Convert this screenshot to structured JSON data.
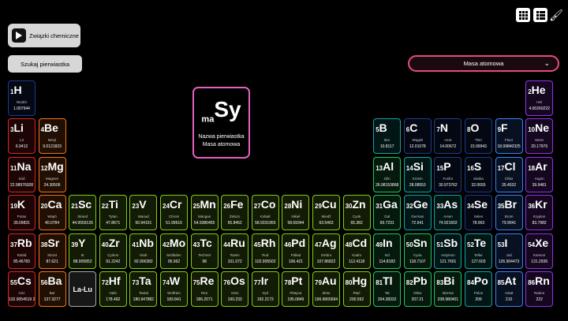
{
  "toolbar": {
    "compounds_label": "Związki chemiczne",
    "search_label": "Szukaj pierwiastka",
    "property_select": "Masa atomowa"
  },
  "legend": {
    "mass_sub": "m",
    "z_sub": "a",
    "symbol": "Sy",
    "name_label": "Nazwa pierwiastka",
    "mass_label": "Masa atomowa"
  },
  "colors": {
    "nonmetal": "#1e3a8a",
    "noble": "#9333ea",
    "alkali": "#dc2626",
    "alkaline": "#f97316",
    "transition": "#84cc16",
    "post": "#22c55e",
    "metalloid": "#0ea5a4",
    "halogen": "#3b82f6",
    "lanth": "#aaaaaa"
  },
  "elements": [
    {
      "z": "1",
      "s": "H",
      "n": "Wodór",
      "m": "1.007944",
      "c": "nonmetal",
      "g": 1,
      "r": 1
    },
    {
      "z": "2",
      "s": "He",
      "n": "Hel",
      "m": "4.00260222",
      "c": "noble",
      "g": 18,
      "r": 1
    },
    {
      "z": "3",
      "s": "Li",
      "n": "Lit",
      "m": "6.9412",
      "c": "alkali",
      "g": 1,
      "r": 2
    },
    {
      "z": "4",
      "s": "Be",
      "n": "Beryl",
      "m": "9.0121823",
      "c": "alkaline",
      "g": 2,
      "r": 2
    },
    {
      "z": "5",
      "s": "B",
      "n": "Bor",
      "m": "10.8117",
      "c": "metalloid",
      "g": 13,
      "r": 2
    },
    {
      "z": "6",
      "s": "C",
      "n": "Węgiel",
      "m": "12.01078",
      "c": "nonmetal",
      "g": 14,
      "r": 2
    },
    {
      "z": "7",
      "s": "N",
      "n": "Azot",
      "m": "14.00672",
      "c": "nonmetal",
      "g": 15,
      "r": 2
    },
    {
      "z": "8",
      "s": "O",
      "n": "Tlen",
      "m": "15.99943",
      "c": "nonmetal",
      "g": 16,
      "r": 2
    },
    {
      "z": "9",
      "s": "F",
      "n": "Fluor",
      "m": "18.99840325",
      "c": "halogen",
      "g": 17,
      "r": 2
    },
    {
      "z": "10",
      "s": "Ne",
      "n": "Neon",
      "m": "20.17976",
      "c": "noble",
      "g": 18,
      "r": 2
    },
    {
      "z": "11",
      "s": "Na",
      "n": "Sód",
      "m": "22.98976928",
      "c": "alkali",
      "g": 1,
      "r": 3
    },
    {
      "z": "12",
      "s": "Mg",
      "n": "Magnez",
      "m": "24.30506",
      "c": "alkaline",
      "g": 2,
      "r": 3
    },
    {
      "z": "13",
      "s": "Al",
      "n": "Glin",
      "m": "26.98153868",
      "c": "post",
      "g": 13,
      "r": 3
    },
    {
      "z": "14",
      "s": "Si",
      "n": "Krzem",
      "m": "28.08553",
      "c": "metalloid",
      "g": 14,
      "r": 3
    },
    {
      "z": "15",
      "s": "P",
      "n": "Fosfor",
      "m": "30.973762",
      "c": "nonmetal",
      "g": 15,
      "r": 3
    },
    {
      "z": "16",
      "s": "S",
      "n": "Siarka",
      "m": "32.0655",
      "c": "nonmetal",
      "g": 16,
      "r": 3
    },
    {
      "z": "17",
      "s": "Cl",
      "n": "Chlor",
      "m": "35.4532",
      "c": "halogen",
      "g": 17,
      "r": 3
    },
    {
      "z": "18",
      "s": "Ar",
      "n": "Argon",
      "m": "39.9481",
      "c": "noble",
      "g": 18,
      "r": 3
    },
    {
      "z": "19",
      "s": "K",
      "n": "Potas",
      "m": "39.09831",
      "c": "alkali",
      "g": 1,
      "r": 4
    },
    {
      "z": "20",
      "s": "Ca",
      "n": "Wapń",
      "m": "40.0784",
      "c": "alkaline",
      "g": 2,
      "r": 4
    },
    {
      "z": "21",
      "s": "Sc",
      "n": "Skand",
      "m": "44.9559126",
      "c": "transition",
      "g": 3,
      "r": 4
    },
    {
      "z": "22",
      "s": "Ti",
      "n": "Tytan",
      "m": "47.8671",
      "c": "transition",
      "g": 4,
      "r": 4
    },
    {
      "z": "23",
      "s": "V",
      "n": "Wanad",
      "m": "50.94151",
      "c": "transition",
      "g": 5,
      "r": 4
    },
    {
      "z": "24",
      "s": "Cr",
      "n": "Chrom",
      "m": "51.99616",
      "c": "transition",
      "g": 6,
      "r": 4
    },
    {
      "z": "25",
      "s": "Mn",
      "n": "Mangan",
      "m": "54.9380455",
      "c": "transition",
      "g": 7,
      "r": 4
    },
    {
      "z": "26",
      "s": "Fe",
      "n": "Żelazo",
      "m": "55.8452",
      "c": "transition",
      "g": 8,
      "r": 4
    },
    {
      "z": "27",
      "s": "Co",
      "n": "Kobalt",
      "m": "58.9331955",
      "c": "transition",
      "g": 9,
      "r": 4
    },
    {
      "z": "28",
      "s": "Ni",
      "n": "Nikiel",
      "m": "58.69344",
      "c": "transition",
      "g": 10,
      "r": 4
    },
    {
      "z": "29",
      "s": "Cu",
      "n": "Miedź",
      "m": "63.5463",
      "c": "transition",
      "g": 11,
      "r": 4
    },
    {
      "z": "30",
      "s": "Zn",
      "n": "Cynk",
      "m": "65.382",
      "c": "transition",
      "g": 12,
      "r": 4
    },
    {
      "z": "31",
      "s": "Ga",
      "n": "Gal",
      "m": "69.7231",
      "c": "post",
      "g": 13,
      "r": 4
    },
    {
      "z": "32",
      "s": "Ge",
      "n": "German",
      "m": "72.641",
      "c": "metalloid",
      "g": 14,
      "r": 4
    },
    {
      "z": "33",
      "s": "As",
      "n": "Arsen",
      "m": "74.921602",
      "c": "metalloid",
      "g": 15,
      "r": 4
    },
    {
      "z": "34",
      "s": "Se",
      "n": "Selen",
      "m": "78.963",
      "c": "nonmetal",
      "g": 16,
      "r": 4
    },
    {
      "z": "35",
      "s": "Br",
      "n": "Brom",
      "m": "79.9041",
      "c": "halogen",
      "g": 17,
      "r": 4
    },
    {
      "z": "36",
      "s": "Kr",
      "n": "Krypton",
      "m": "83.7982",
      "c": "noble",
      "g": 18,
      "r": 4
    },
    {
      "z": "37",
      "s": "Rb",
      "n": "Rubid",
      "m": "85.46783",
      "c": "alkali",
      "g": 1,
      "r": 5
    },
    {
      "z": "38",
      "s": "Sr",
      "n": "Stront",
      "m": "87.621",
      "c": "alkaline",
      "g": 2,
      "r": 5
    },
    {
      "z": "39",
      "s": "Y",
      "n": "Itr",
      "m": "88.905852",
      "c": "transition",
      "g": 3,
      "r": 5
    },
    {
      "z": "40",
      "s": "Zr",
      "n": "Cyrkon",
      "m": "91.2242",
      "c": "transition",
      "g": 4,
      "r": 5
    },
    {
      "z": "41",
      "s": "Nb",
      "n": "Niob",
      "m": "92.906382",
      "c": "transition",
      "g": 5,
      "r": 5
    },
    {
      "z": "42",
      "s": "Mo",
      "n": "Molibden",
      "m": "95.962",
      "c": "transition",
      "g": 6,
      "r": 5
    },
    {
      "z": "43",
      "s": "Tc",
      "n": "Technet",
      "m": "98",
      "c": "transition",
      "g": 7,
      "r": 5
    },
    {
      "z": "44",
      "s": "Ru",
      "n": "Ruten",
      "m": "101.072",
      "c": "transition",
      "g": 8,
      "r": 5
    },
    {
      "z": "45",
      "s": "Rh",
      "n": "Rod",
      "m": "102.905502",
      "c": "transition",
      "g": 9,
      "r": 5
    },
    {
      "z": "46",
      "s": "Pd",
      "n": "Pallad",
      "m": "106.421",
      "c": "transition",
      "g": 10,
      "r": 5
    },
    {
      "z": "47",
      "s": "Ag",
      "n": "Srebro",
      "m": "107.86822",
      "c": "transition",
      "g": 11,
      "r": 5
    },
    {
      "z": "48",
      "s": "Cd",
      "n": "Kadm",
      "m": "112.4118",
      "c": "transition",
      "g": 12,
      "r": 5
    },
    {
      "z": "49",
      "s": "In",
      "n": "Ind",
      "m": "114.8183",
      "c": "post",
      "g": 13,
      "r": 5
    },
    {
      "z": "50",
      "s": "Sn",
      "n": "Cyna",
      "m": "118.7107",
      "c": "post",
      "g": 14,
      "r": 5
    },
    {
      "z": "51",
      "s": "Sb",
      "n": "Antymon",
      "m": "121.7601",
      "c": "metalloid",
      "g": 15,
      "r": 5
    },
    {
      "z": "52",
      "s": "Te",
      "n": "Tellur",
      "m": "127.603",
      "c": "metalloid",
      "g": 16,
      "r": 5
    },
    {
      "z": "53",
      "s": "I",
      "n": "Jod",
      "m": "126.904473",
      "c": "halogen",
      "g": 17,
      "r": 5
    },
    {
      "z": "54",
      "s": "Xe",
      "n": "Ksenon",
      "m": "131.2936",
      "c": "noble",
      "g": 18,
      "r": 5
    },
    {
      "z": "55",
      "s": "Cs",
      "n": "Cez",
      "m": "132.9054519 2",
      "c": "alkali",
      "g": 1,
      "r": 6
    },
    {
      "z": "56",
      "s": "Ba",
      "n": "Bar",
      "m": "137.3277",
      "c": "alkaline",
      "g": 2,
      "r": 6
    },
    {
      "z": "",
      "s": "La-Lu",
      "n": "",
      "m": "",
      "c": "lanth",
      "g": 3,
      "r": 6
    },
    {
      "z": "72",
      "s": "Hf",
      "n": "Hafn",
      "m": "178.492",
      "c": "transition",
      "g": 4,
      "r": 6
    },
    {
      "z": "73",
      "s": "Ta",
      "n": "Tantal",
      "m": "180.947882",
      "c": "transition",
      "g": 5,
      "r": 6
    },
    {
      "z": "74",
      "s": "W",
      "n": "Wolfram",
      "m": "183.841",
      "c": "transition",
      "g": 6,
      "r": 6
    },
    {
      "z": "75",
      "s": "Re",
      "n": "Ren",
      "m": "186.2071",
      "c": "transition",
      "g": 7,
      "r": 6
    },
    {
      "z": "76",
      "s": "Os",
      "n": "Osm",
      "m": "190.233",
      "c": "transition",
      "g": 8,
      "r": 6
    },
    {
      "z": "77",
      "s": "Ir",
      "n": "Iryd",
      "m": "192.2173",
      "c": "transition",
      "g": 9,
      "r": 6
    },
    {
      "z": "78",
      "s": "Pt",
      "n": "Platyna",
      "m": "195.0849",
      "c": "transition",
      "g": 10,
      "r": 6
    },
    {
      "z": "79",
      "s": "Au",
      "n": "Złoto",
      "m": "196.9665694",
      "c": "transition",
      "g": 11,
      "r": 6
    },
    {
      "z": "80",
      "s": "Hg",
      "n": "Rtęć",
      "m": "200.592",
      "c": "transition",
      "g": 12,
      "r": 6
    },
    {
      "z": "81",
      "s": "Tl",
      "n": "Tal",
      "m": "204.38332",
      "c": "post",
      "g": 13,
      "r": 6
    },
    {
      "z": "82",
      "s": "Pb",
      "n": "Ołów",
      "m": "207.21",
      "c": "post",
      "g": 14,
      "r": 6
    },
    {
      "z": "83",
      "s": "Bi",
      "n": "Bizmut",
      "m": "208.980401",
      "c": "post",
      "g": 15,
      "r": 6
    },
    {
      "z": "84",
      "s": "Po",
      "n": "Polon",
      "m": "209",
      "c": "metalloid",
      "g": 16,
      "r": 6
    },
    {
      "z": "85",
      "s": "At",
      "n": "Astat",
      "m": "210",
      "c": "halogen",
      "g": 17,
      "r": 6
    },
    {
      "z": "86",
      "s": "Rn",
      "n": "Radon",
      "m": "222",
      "c": "noble",
      "g": 18,
      "r": 6
    }
  ]
}
